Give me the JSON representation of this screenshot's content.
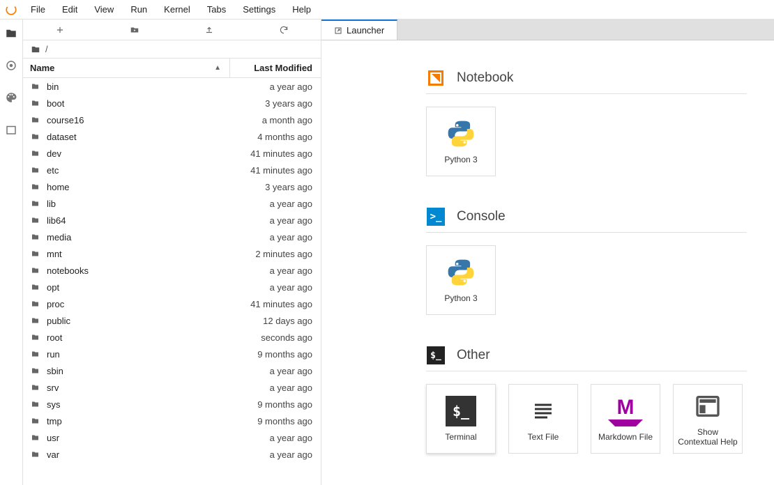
{
  "menu": {
    "items": [
      "File",
      "Edit",
      "View",
      "Run",
      "Kernel",
      "Tabs",
      "Settings",
      "Help"
    ]
  },
  "filebrowser": {
    "breadcrumb": "/",
    "columns": {
      "name": "Name",
      "modified": "Last Modified"
    },
    "rows": [
      {
        "name": "bin",
        "modified": "a year ago"
      },
      {
        "name": "boot",
        "modified": "3 years ago"
      },
      {
        "name": "course16",
        "modified": "a month ago"
      },
      {
        "name": "dataset",
        "modified": "4 months ago"
      },
      {
        "name": "dev",
        "modified": "41 minutes ago"
      },
      {
        "name": "etc",
        "modified": "41 minutes ago"
      },
      {
        "name": "home",
        "modified": "3 years ago"
      },
      {
        "name": "lib",
        "modified": "a year ago"
      },
      {
        "name": "lib64",
        "modified": "a year ago"
      },
      {
        "name": "media",
        "modified": "a year ago"
      },
      {
        "name": "mnt",
        "modified": "2 minutes ago"
      },
      {
        "name": "notebooks",
        "modified": "a year ago"
      },
      {
        "name": "opt",
        "modified": "a year ago"
      },
      {
        "name": "proc",
        "modified": "41 minutes ago"
      },
      {
        "name": "public",
        "modified": "12 days ago"
      },
      {
        "name": "root",
        "modified": "seconds ago"
      },
      {
        "name": "run",
        "modified": "9 months ago"
      },
      {
        "name": "sbin",
        "modified": "a year ago"
      },
      {
        "name": "srv",
        "modified": "a year ago"
      },
      {
        "name": "sys",
        "modified": "9 months ago"
      },
      {
        "name": "tmp",
        "modified": "9 months ago"
      },
      {
        "name": "usr",
        "modified": "a year ago"
      },
      {
        "name": "var",
        "modified": "a year ago"
      }
    ]
  },
  "tab": {
    "title": "Launcher"
  },
  "launcher": {
    "sections": [
      {
        "title": "Notebook",
        "kind": "notebook",
        "cards": [
          {
            "label": "Python 3",
            "icon": "python"
          }
        ]
      },
      {
        "title": "Console",
        "kind": "console",
        "cards": [
          {
            "label": "Python 3",
            "icon": "python"
          }
        ]
      },
      {
        "title": "Other",
        "kind": "other",
        "cards": [
          {
            "label": "Terminal",
            "icon": "terminal"
          },
          {
            "label": "Text File",
            "icon": "text"
          },
          {
            "label": "Markdown File",
            "icon": "markdown"
          },
          {
            "label": "Show Contextual Help",
            "icon": "help"
          }
        ]
      }
    ]
  }
}
